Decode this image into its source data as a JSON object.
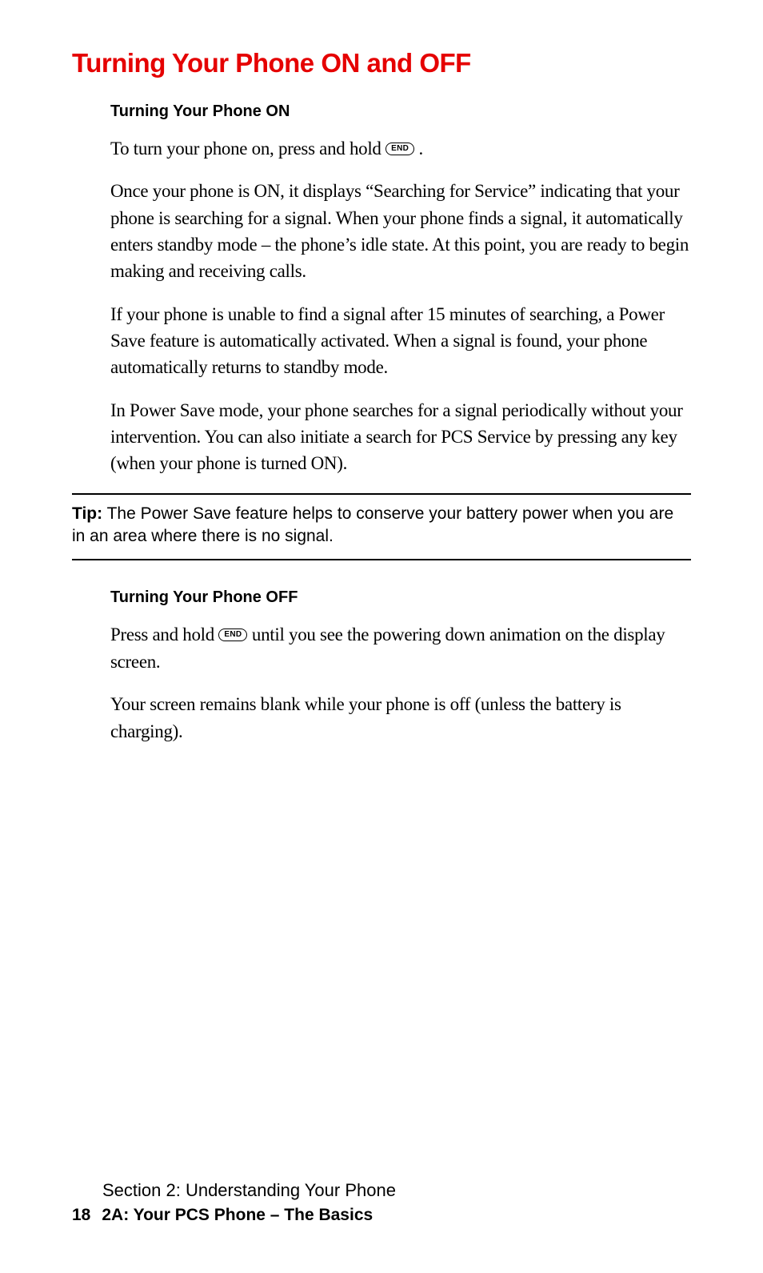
{
  "heading": "Turning Your Phone ON and OFF",
  "section_on": {
    "title": "Turning Your Phone ON",
    "intro_pre": "To turn your phone on, press and hold ",
    "end_key": "END",
    "intro_post": " .",
    "para2": "Once your phone is ON, it displays “Searching for Service” indicating that your phone is searching for a signal. When your phone finds a signal, it automatically enters standby mode – the phone’s idle state. At this point, you are ready to begin making and receiving calls.",
    "para3": "If your phone is unable to find a signal after 15 minutes of searching, a Power Save feature is automatically activated. When a signal is found, your phone automatically returns to standby mode.",
    "para4": "In Power Save mode, your phone searches for a signal periodically without your intervention. You can also initiate a search for PCS Service by pressing any key (when your phone is turned ON)."
  },
  "tip": {
    "label": "Tip:",
    "text": " The Power Save feature helps to conserve your battery power when you are in an area where there is no signal."
  },
  "section_off": {
    "title": "Turning Your Phone OFF",
    "para1_pre": "Press and hold ",
    "end_key": "END",
    "para1_post": " until you see the powering down animation on the display screen.",
    "para2": "Your screen remains blank while your phone is off (unless the battery is charging)."
  },
  "footer": {
    "section_line": "Section 2: Understanding Your Phone",
    "page_number": "18",
    "chapter": "2A: Your PCS Phone – The Basics"
  }
}
